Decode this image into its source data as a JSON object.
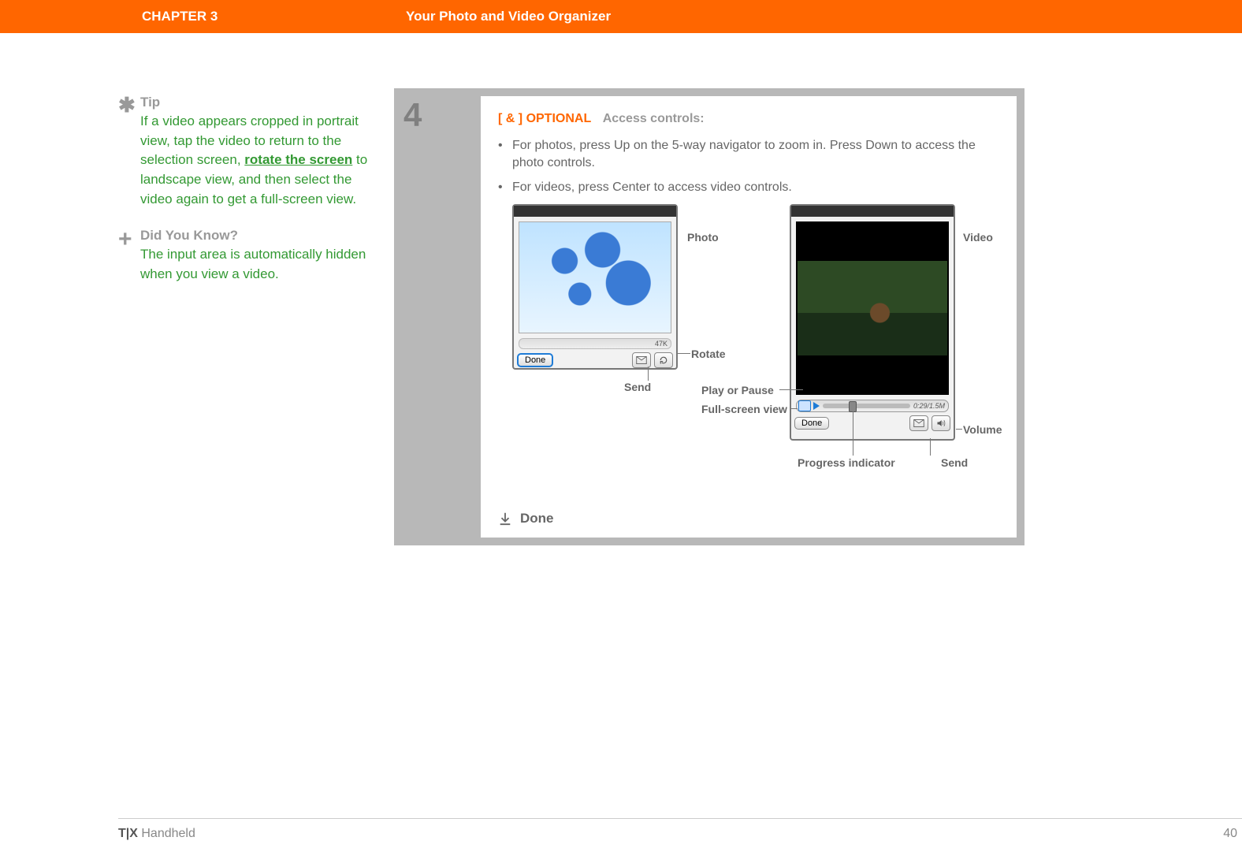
{
  "header": {
    "chapter": "CHAPTER 3",
    "title": "Your Photo and Video Organizer"
  },
  "sidebar": {
    "tip": {
      "heading": "Tip",
      "text_before": "If a video appears cropped in portrait view, tap the video to return to the selection screen, ",
      "link_text": "rotate the screen",
      "text_after": " to landscape view, and then select the video again to get a full-screen view."
    },
    "dyk": {
      "heading": "Did You Know?",
      "text": "The input area is automatically hidden when you view a video."
    }
  },
  "step": {
    "number": "4",
    "optional_bracket": "[ & ]",
    "optional_word": "OPTIONAL",
    "optional_desc": "Access controls:",
    "bullets": [
      "For photos, press Up on the 5-way navigator to zoom in. Press Down to access the photo controls.",
      "For videos, press Center to access video controls."
    ],
    "done_label": "Done"
  },
  "photo": {
    "label": "Photo",
    "size": "47K",
    "done_button": "Done",
    "callouts": {
      "rotate": "Rotate",
      "send": "Send"
    }
  },
  "video": {
    "label": "Video",
    "time": "0:29/1.5M",
    "done_button": "Done",
    "callouts": {
      "play_pause": "Play or Pause",
      "full_screen": "Full-screen view",
      "progress": "Progress indicator",
      "send": "Send",
      "volume": "Volume"
    }
  },
  "footer": {
    "product_bold": "T|X",
    "product_rest": " Handheld",
    "page": "40"
  }
}
